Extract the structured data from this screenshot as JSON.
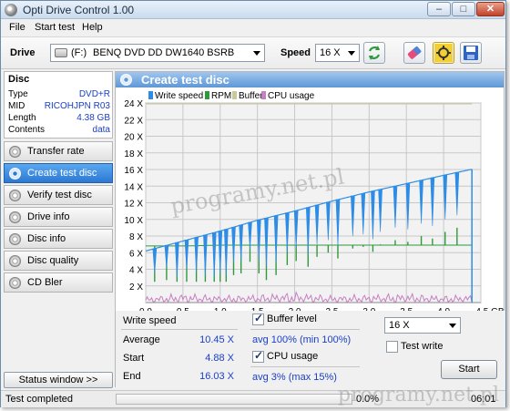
{
  "window": {
    "title": "Opti Drive Control 1.00",
    "controls": {
      "minimize": "–",
      "maximize": "□",
      "close": "✕"
    }
  },
  "menu": [
    "File",
    "Start test",
    "Help"
  ],
  "toolbar": {
    "drive_label": "Drive",
    "drive_letter": "(F:)",
    "drive_name": "BENQ DVD DD DW1640 BSRB",
    "speed_label": "Speed",
    "speed_value": "16 X",
    "icons": [
      "refresh-icon",
      "eraser-icon",
      "settings-icon",
      "save-icon"
    ]
  },
  "disc": {
    "heading": "Disc",
    "rows": [
      {
        "key": "Type",
        "value": "DVD+R"
      },
      {
        "key": "MID",
        "value": "RICOHJPN R03"
      },
      {
        "key": "Length",
        "value": "4.38 GB"
      },
      {
        "key": "Contents",
        "value": "data"
      }
    ]
  },
  "nav": {
    "items": [
      "Transfer rate",
      "Create test disc",
      "Verify test disc",
      "Drive info",
      "Disc info",
      "Disc quality",
      "CD Bler"
    ],
    "active": "Create test disc"
  },
  "status_window_label": "Status window >>",
  "panel": {
    "title": "Create test disc"
  },
  "chart_data": {
    "type": "line",
    "legend": [
      "Write speed",
      "RPM",
      "Buffer",
      "CPU usage"
    ],
    "legend_colors": [
      "#2d8de6",
      "#2f9a3a",
      "#c9c99a",
      "#c77fc4"
    ],
    "legend_position": "top",
    "xlabel": "",
    "ylabel": "",
    "xlim": [
      0,
      4.5
    ],
    "ylim": [
      0,
      24
    ],
    "x_ticks": [
      "0.0",
      "0.5",
      "1.0",
      "1.5",
      "2.0",
      "2.5",
      "3.0",
      "3.5",
      "4.0",
      "4.5 GB"
    ],
    "y_ticks": [
      "2 X",
      "4 X",
      "6 X",
      "8 X",
      "10 X",
      "12 X",
      "14 X",
      "16 X",
      "18 X",
      "20 X",
      "22 X",
      "24 X"
    ],
    "grid": true,
    "series": [
      {
        "name": "Write speed",
        "x": [
          0.0,
          0.5,
          1.0,
          1.5,
          2.0,
          2.5,
          3.0,
          3.5,
          4.0,
          4.38
        ],
        "values": [
          6.2,
          7.4,
          8.6,
          9.9,
          11.0,
          12.2,
          13.3,
          14.3,
          15.3,
          16.03
        ]
      },
      {
        "name": "RPM",
        "x": [
          0.0,
          0.5,
          1.0,
          1.5,
          2.0,
          2.5,
          3.0,
          3.5,
          4.0,
          4.38
        ],
        "values": [
          6.8,
          6.8,
          6.9,
          6.9,
          6.9,
          6.9,
          6.9,
          6.9,
          6.9,
          6.9
        ]
      },
      {
        "name": "Buffer",
        "x": [
          0.0,
          4.38
        ],
        "values": [
          24,
          24
        ]
      },
      {
        "name": "CPU usage",
        "x": [
          0.0,
          0.5,
          1.0,
          1.5,
          2.0,
          2.5,
          3.0,
          3.5,
          4.0,
          4.38
        ],
        "values": [
          0.5,
          0.8,
          0.6,
          0.7,
          0.9,
          0.6,
          0.7,
          0.8,
          0.6,
          0.7
        ]
      }
    ],
    "write_speed_dip_x": [
      0.12,
      0.28,
      0.42,
      0.55,
      0.68,
      0.8,
      0.92,
      1.0,
      1.08,
      1.18,
      1.28,
      1.4,
      1.52,
      1.62,
      1.75,
      1.9,
      2.02,
      2.18,
      2.3,
      2.45,
      2.58,
      2.78,
      2.92,
      3.05,
      3.15,
      3.35,
      3.52,
      3.7,
      3.85,
      4.02,
      4.18
    ],
    "write_speed_dip_min": [
      3.5,
      4.2,
      3.0,
      4.0,
      3.6,
      3.2,
      3.0,
      3.4,
      3.2,
      4.8,
      5.0,
      6.4,
      5.0,
      4.2,
      4.8,
      6.0,
      6.5,
      5.8,
      7.0,
      7.5,
      6.8,
      8.0,
      8.2,
      7.6,
      8.5,
      9.0,
      8.8,
      9.5,
      9.2,
      10.0,
      10.5
    ]
  },
  "stats": {
    "write_speed_label": "Write speed",
    "average_label": "Average",
    "average_value": "10.45 X",
    "start_label": "Start",
    "start_value": "4.88 X",
    "end_label": "End",
    "end_value": "16.03 X",
    "buffer_level_label": "Buffer level",
    "buffer_level_value": "avg 100% (min 100%)",
    "cpu_usage_label": "CPU usage",
    "cpu_usage_value": "avg 3% (max 15%)",
    "speed_select": "16 X",
    "test_write_label": "Test write",
    "start_button": "Start"
  },
  "statusbar": {
    "text": "Test completed",
    "progress_percent": "0.0%",
    "progress_value": 0,
    "time": "06:01"
  },
  "watermark": "programy.net.pl"
}
